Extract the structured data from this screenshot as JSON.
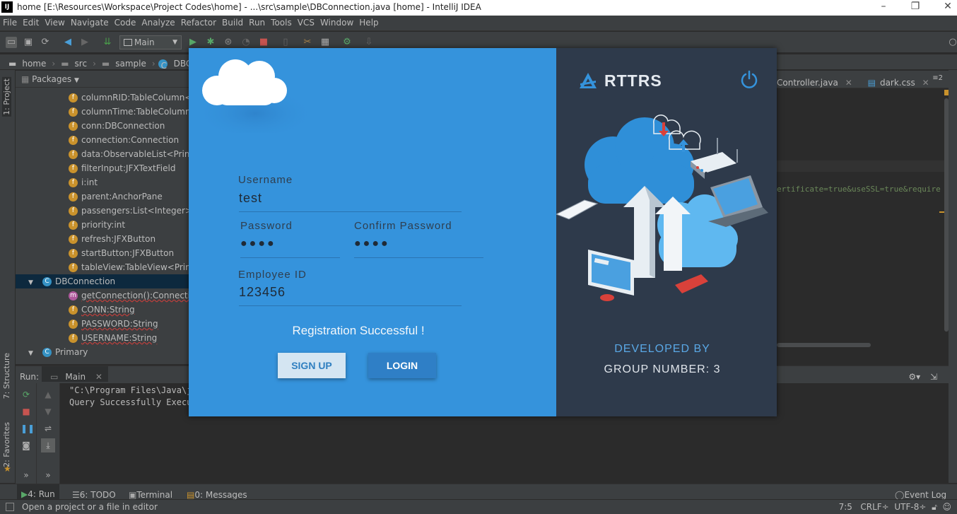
{
  "window": {
    "title": "home [E:\\Resources\\Workspace\\Project Codes\\home] - ...\\src\\sample\\DBConnection.java [home] - IntelliJ IDEA",
    "logo": "IJ"
  },
  "menu": [
    "File",
    "Edit",
    "View",
    "Navigate",
    "Code",
    "Analyze",
    "Refactor",
    "Build",
    "Run",
    "Tools",
    "VCS",
    "Window",
    "Help"
  ],
  "toolbar": {
    "run_config": "Main"
  },
  "breadcrumb": [
    "home",
    "src",
    "sample",
    "DBConnect"
  ],
  "left_tabs": [
    "1: Project",
    "7: Structure",
    "2: Favorites"
  ],
  "project": {
    "view_label": "Packages",
    "rows": [
      {
        "kind": "field",
        "text": "columnRID:TableColumn<Pr"
      },
      {
        "kind": "field",
        "text": "columnTime:TableColumn<"
      },
      {
        "kind": "field",
        "text": "conn:DBConnection"
      },
      {
        "kind": "field",
        "text": "connection:Connection"
      },
      {
        "kind": "field",
        "text": "data:ObservableList<Primary"
      },
      {
        "kind": "field",
        "text": "filterInput:JFXTextField"
      },
      {
        "kind": "field",
        "text": "i:int"
      },
      {
        "kind": "field",
        "text": "parent:AnchorPane"
      },
      {
        "kind": "field",
        "text": "passengers:List<Integer>"
      },
      {
        "kind": "field",
        "text": "priority:int"
      },
      {
        "kind": "field",
        "text": "refresh:JFXButton"
      },
      {
        "kind": "field",
        "text": "startButton:JFXButton"
      },
      {
        "kind": "field",
        "text": "tableView:TableView<Primar"
      },
      {
        "kind": "class",
        "text": "DBConnection",
        "selected": true
      },
      {
        "kind": "method",
        "text": "getConnection():Connection"
      },
      {
        "kind": "field",
        "text": "CONN:String"
      },
      {
        "kind": "field",
        "text": "PASSWORD:String"
      },
      {
        "kind": "field",
        "text": "USERNAME:String"
      },
      {
        "kind": "class",
        "text": "Primary"
      }
    ]
  },
  "editor": {
    "tabs": [
      "Controller.java",
      "dark.css"
    ],
    "tabs_overflow": "≡2",
    "code_fragment": "ertificate=true&useSSL=true&require"
  },
  "run": {
    "label": "Run:",
    "tab": "Main",
    "console": [
      "\"C:\\Program Files\\Java\\jd",
      "Query Successfully Execu"
    ]
  },
  "bottom_tabs": [
    {
      "label": "4: Run"
    },
    {
      "label": "6: TODO"
    },
    {
      "label": "Terminal"
    },
    {
      "label": "0: Messages"
    }
  ],
  "event_log": "Event Log",
  "status": {
    "message": "Open a project or a file in editor",
    "position": "7:5",
    "line_sep": "CRLF÷",
    "encoding": "UTF-8÷"
  },
  "dialog": {
    "username_label": "Username",
    "username_value": "test",
    "password_label": "Password",
    "password_value": "●●●●",
    "confirm_label": "Confirm  Password",
    "confirm_value": "●●●●",
    "employee_label": "Employee  ID",
    "employee_value": "123456",
    "message": "Registration Successful !",
    "signup": "SIGN UP",
    "login": "LOGIN",
    "brand": "RTTRS",
    "developed_by": "DEVELOPED  BY",
    "group": "GROUP  NUMBER:  3",
    "colors": {
      "left": "#3593dc",
      "right": "#2e3a4b",
      "accent": "#5aa8e6"
    }
  }
}
